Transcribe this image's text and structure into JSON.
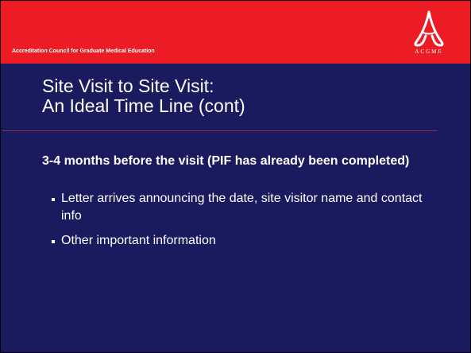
{
  "header": {
    "organization": "Accreditation Council for Graduate Medical Education",
    "logo_text": "ACGME",
    "color": "#ed1c24"
  },
  "slide": {
    "background_color": "#1a1a5e",
    "title_lines": [
      "Site Visit to Site Visit:",
      "An Ideal Time Line (cont)"
    ],
    "subheading": "3-4 months before the visit (PIF has already been completed)",
    "bullets": [
      "Letter arrives announcing the date, site visitor name and contact info",
      "Other important information"
    ]
  }
}
